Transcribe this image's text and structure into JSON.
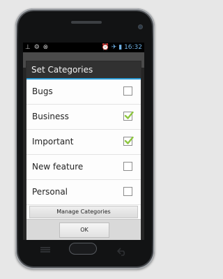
{
  "status_bar": {
    "left_icons": "⊥ ⚙ ⊗",
    "right_icons": "⏰ ✈ ▮",
    "time": "16:32"
  },
  "dialog": {
    "title": "Set Categories",
    "categories": [
      {
        "label": "Bugs",
        "checked": false
      },
      {
        "label": "Business",
        "checked": true
      },
      {
        "label": "Important",
        "checked": true
      },
      {
        "label": "New feature",
        "checked": false
      },
      {
        "label": "Personal",
        "checked": false
      }
    ],
    "manage_button": "Manage Categories",
    "ok_button": "OK"
  },
  "colors": {
    "accent_underline": "#2b9bd6",
    "checkmark": "#8dc63f",
    "status_text": "#6fb1e5"
  },
  "icons": {
    "menu_key": "menu-icon",
    "home_key": "home-button",
    "back_key": "back-icon"
  }
}
